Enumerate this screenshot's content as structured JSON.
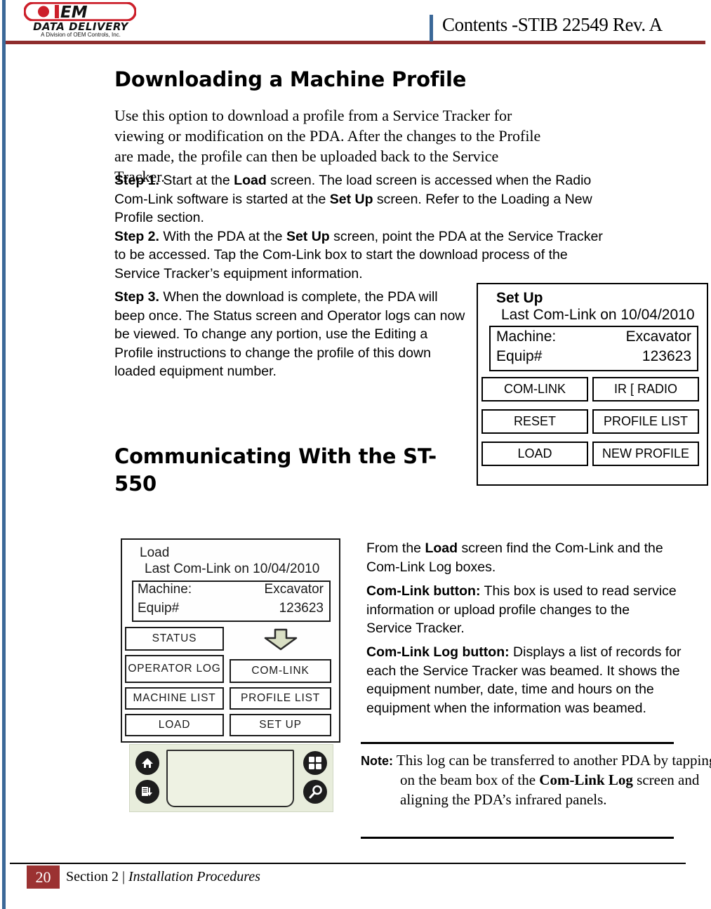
{
  "header": {
    "title": "Contents -STIB 22549 Rev. A",
    "logo": {
      "mark": "OEM",
      "tagline": "DATA DELIVERY",
      "subline": "A Division of OEM Controls, Inc."
    }
  },
  "headings": {
    "main": "Downloading a Machine Profile",
    "second": "Communicating With the ST-550"
  },
  "body": {
    "intro": "Use this option to download a profile from a Service Tracker for viewing or modification on the PDA. After the changes to the Profile are made, the profile can then be uploaded back to the Service Tracker.",
    "step1_label": "Step 1.",
    "step1_text_a": " Start at the ",
    "step1_bold_load": "Load",
    "step1_text_b": " screen. The load screen is accessed when the Radio Com-Link software is started at the ",
    "step1_bold_setup": "Set Up",
    "step1_text_c": " screen. Refer to the Loading a New Profile section.",
    "step2_label": "Step 2.",
    "step2_text_a": " With the PDA at the ",
    "step2_bold_setup": "Set Up",
    "step2_text_b": " screen, point the PDA at the Service Tracker to be accessed. Tap the Com-Link box to start the download process of the Service Tracker’s equipment information.",
    "step3_label": "Step 3.",
    "step3_text": " When the download is complete, the PDA will beep once. The Status screen and Operator logs can now be viewed. To change any portion, use the Editing a Profile instructions to change the profile of this down loaded equipment number."
  },
  "right_column": {
    "p1_a": "From the ",
    "p1_bold": "Load",
    "p1_b": " screen find the Com-Link and the Com-Link Log boxes.",
    "p2_label": "Com-Link button:",
    "p2_text": " This box is used to read service information or upload profile changes to the Service Tracker.",
    "p3_label": "Com-Link Log button:",
    "p3_text": " Displays a list of records for each the Service Tracker was beamed. It shows the equipment number, date, time and hours on the equipment when the information was beamed."
  },
  "note": {
    "label": "Note:",
    "text_a": " This log can be transferred to another PDA by tapping on the beam box of the ",
    "bold": "Com-Link Log",
    "text_b": " screen and aligning the PDA’s infrared panels."
  },
  "setup_screen": {
    "title": "Set Up",
    "subtitle": "Last Com-Link on 10/04/2010",
    "machine_label": "Machine:",
    "machine_value": "Excavator",
    "equip_label": "Equip#",
    "equip_value": "123623",
    "buttons": {
      "com_link": "COM-LINK",
      "ir_radio": "IR [ RADIO",
      "reset": "RESET",
      "profile_list": "PROFILE LIST",
      "load": "LOAD",
      "new_profile": "NEW PROFILE"
    }
  },
  "load_screen": {
    "title": "Load",
    "subtitle": "Last Com-Link on 10/04/2010",
    "machine_label": "Machine:",
    "machine_value": "Excavator",
    "equip_label": "Equip#",
    "equip_value": "123623",
    "buttons": {
      "status": "STATUS",
      "operator_log": "OPERATOR LOG",
      "machine_list": "MACHINE LIST",
      "load": "LOAD",
      "com_link": "COM-LINK",
      "profile_list": "PROFILE LIST",
      "set_up": "SET UP"
    }
  },
  "footer": {
    "page_number": "20",
    "section": "Section 2 | ",
    "section_italic": "Installation Procedures"
  },
  "colors": {
    "accent_blue": "#3b6898",
    "accent_red": "#8f2d2d",
    "footer_red": "#9b3232",
    "logo_red": "#cc1f2a"
  }
}
